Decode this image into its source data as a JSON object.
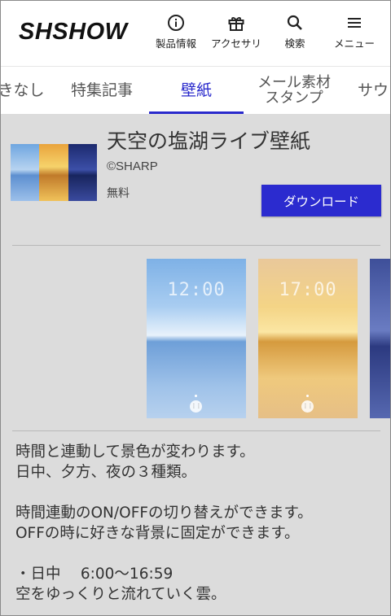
{
  "header": {
    "logo": "SHSHOW",
    "nav": [
      {
        "label": "製品情報",
        "icon": "info-icon"
      },
      {
        "label": "アクセサリ",
        "icon": "gift-icon"
      },
      {
        "label": "検索",
        "icon": "search-icon"
      },
      {
        "label": "メニュー",
        "icon": "menu-icon"
      }
    ]
  },
  "tabs": [
    {
      "label": "きなし",
      "active": false
    },
    {
      "label": "特集記事",
      "active": false
    },
    {
      "label": "壁紙",
      "active": true
    },
    {
      "label": "メール素材\nスタンプ",
      "active": false
    },
    {
      "label": "サウ",
      "active": false
    }
  ],
  "product": {
    "title": "天空の塩湖ライブ壁紙",
    "copyright": "©SHARP",
    "price": "無料",
    "download_label": "ダウンロード"
  },
  "screenshots": [
    {
      "time": "12:00",
      "theme": "day"
    },
    {
      "time": "17:00",
      "theme": "evening"
    },
    {
      "time": "",
      "theme": "night"
    }
  ],
  "description": "時間と連動して景色が変わります。\n日中、夕方、夜の３種類。\n\n時間連動のON/OFFの切り替えができます。\nOFFの時に好きな背景に固定ができます。\n\n・日中　 6:00〜16:59\n空をゆっくりと流れていく雲。",
  "colors": {
    "accent": "#2a2acc",
    "button": "#2b2bcf",
    "background": "#dcdcdc"
  }
}
